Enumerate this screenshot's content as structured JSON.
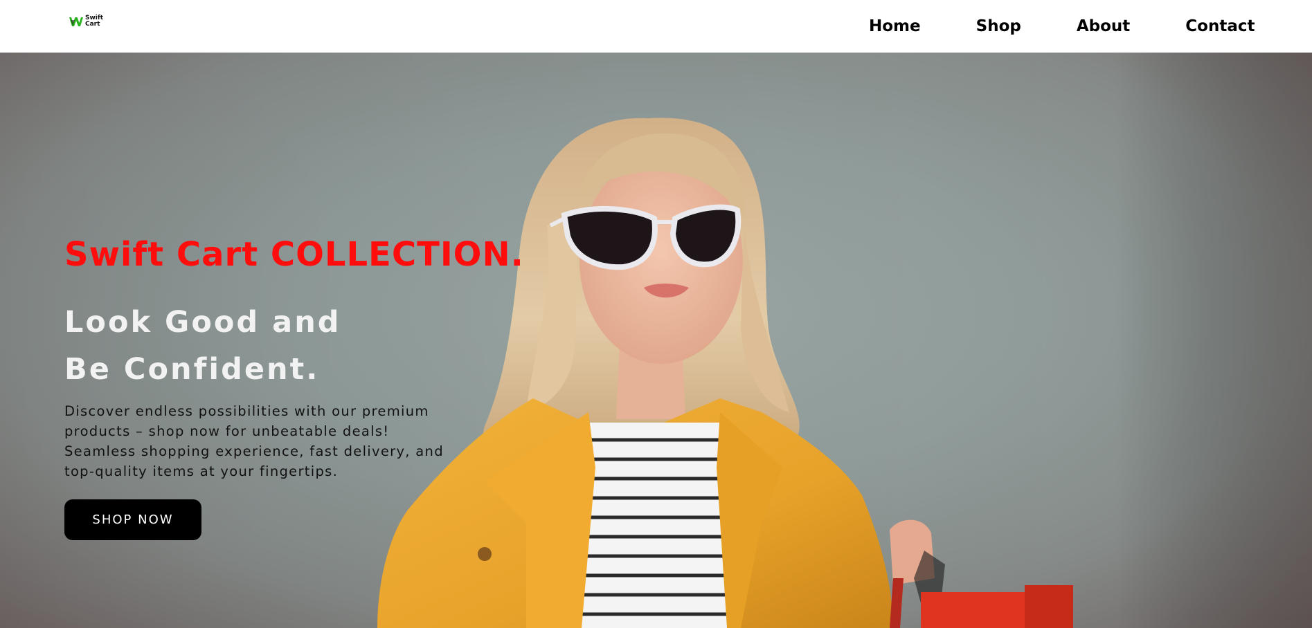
{
  "brand": {
    "name_line1": "Swift",
    "name_line2": "Cart",
    "logo_icon": "swift-cart-logo-icon",
    "accent_color": "#2bb31f"
  },
  "nav": {
    "items": [
      {
        "label": "Home"
      },
      {
        "label": "Shop"
      },
      {
        "label": "About"
      },
      {
        "label": "Contact"
      }
    ]
  },
  "hero": {
    "title": "Swift Cart COLLECTION.",
    "title_color": "#ff0d0d",
    "subtitle_line1": "Look Good and",
    "subtitle_line2": "Be Confident.",
    "description": "Discover endless possibilities with our premium products – shop now for unbeatable deals! Seamless shopping experience, fast delivery, and top-quality items at your fingertips.",
    "cta_label": "SHOP NOW"
  }
}
